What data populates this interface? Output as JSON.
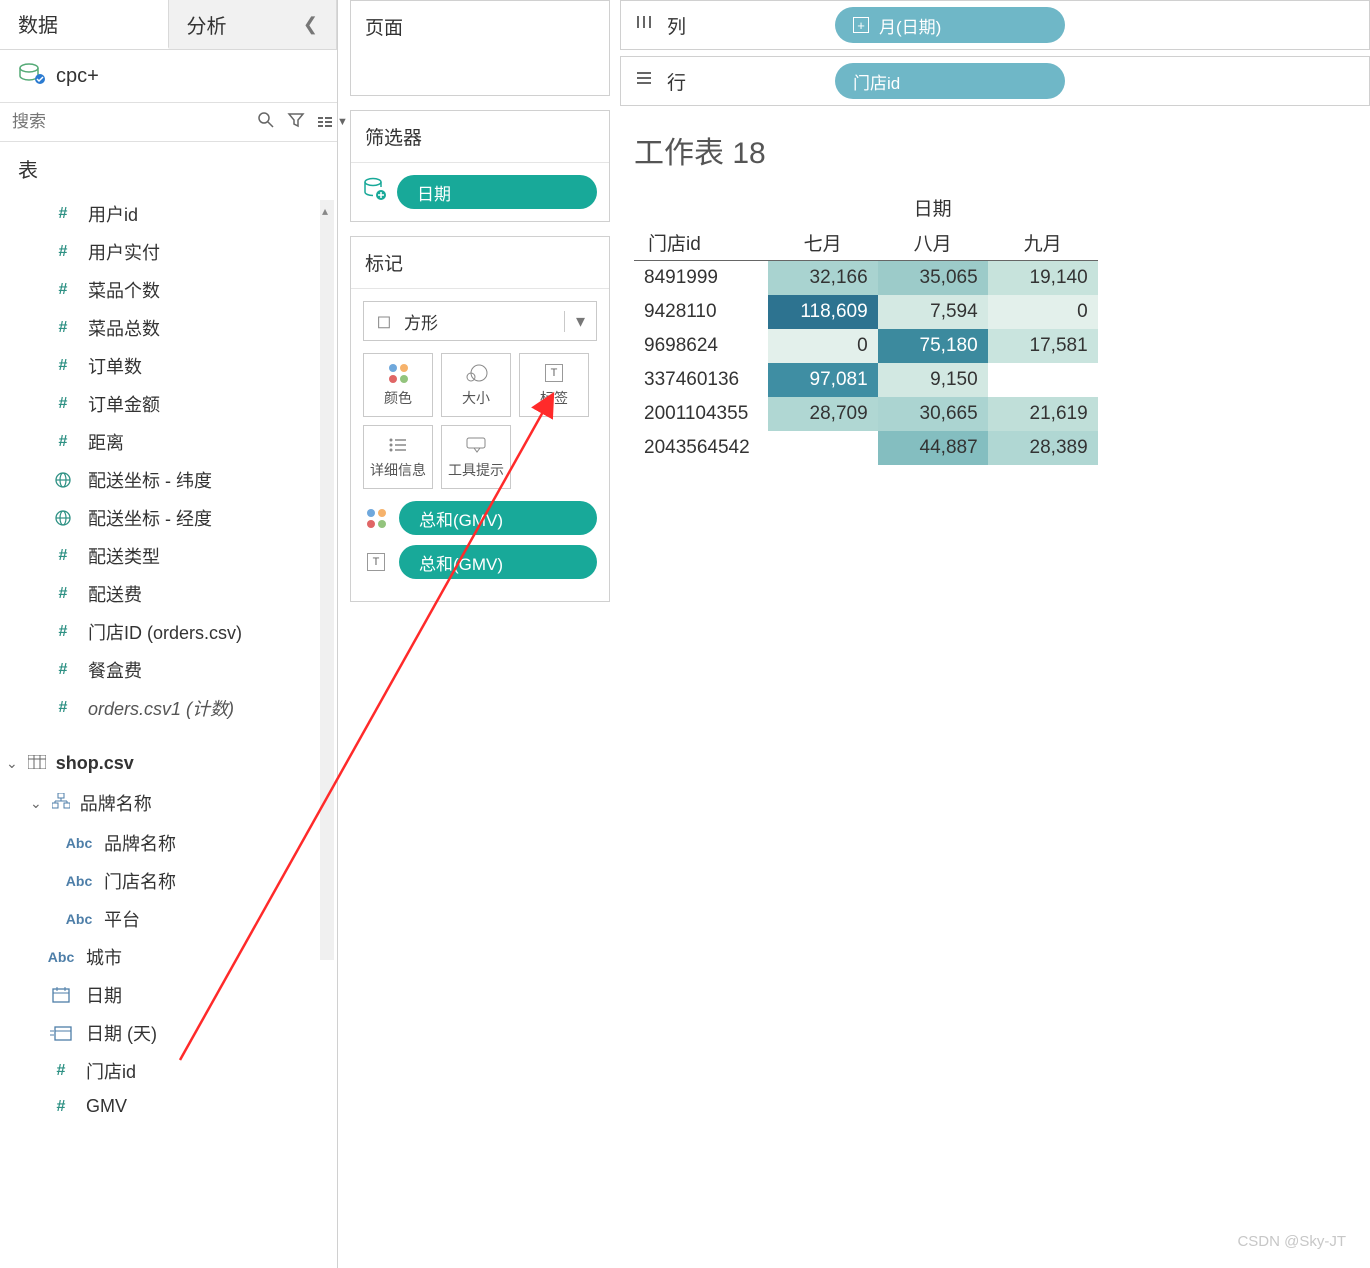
{
  "tabs": {
    "data": "数据",
    "analysis": "分析"
  },
  "datasource": "cpc+",
  "search_placeholder": "搜索",
  "section_tables": "表",
  "fields_orders": [
    {
      "icon": "hash",
      "label": "用户id"
    },
    {
      "icon": "hash",
      "label": "用户实付"
    },
    {
      "icon": "hash",
      "label": "菜品个数"
    },
    {
      "icon": "hash",
      "label": "菜品总数"
    },
    {
      "icon": "hash",
      "label": "订单数"
    },
    {
      "icon": "hash",
      "label": "订单金额"
    },
    {
      "icon": "hash",
      "label": "距离"
    },
    {
      "icon": "globe",
      "label": "配送坐标 - 纬度"
    },
    {
      "icon": "globe",
      "label": "配送坐标 - 经度"
    },
    {
      "icon": "hash",
      "label": "配送类型"
    },
    {
      "icon": "hash",
      "label": "配送费"
    },
    {
      "icon": "hash",
      "label": "门店ID (orders.csv)"
    },
    {
      "icon": "hash",
      "label": "餐盒费"
    },
    {
      "icon": "hash",
      "label": "orders.csv1 (计数)",
      "italic": true
    }
  ],
  "shop_table": "shop.csv",
  "hierarchy": "品牌名称",
  "shop_fields": [
    {
      "icon": "abc",
      "label": "品牌名称",
      "indent": "sub2"
    },
    {
      "icon": "abc",
      "label": "门店名称",
      "indent": "sub2"
    },
    {
      "icon": "abc",
      "label": "平台",
      "indent": "sub2"
    },
    {
      "icon": "abc",
      "label": "城市",
      "indent": "sub3"
    },
    {
      "icon": "date",
      "label": "日期",
      "indent": "sub3"
    },
    {
      "icon": "date2",
      "label": "日期 (天)",
      "indent": "sub3"
    },
    {
      "icon": "hash",
      "label": "门店id",
      "indent": "sub3"
    },
    {
      "icon": "hash",
      "label": "GMV",
      "indent": "sub3"
    }
  ],
  "pages_title": "页面",
  "filters_title": "筛选器",
  "filter_pill": "日期",
  "marks_title": "标记",
  "mark_type": "方形",
  "mark_buttons": {
    "color": "颜色",
    "size": "大小",
    "label": "标签",
    "detail": "详细信息",
    "tooltip": "工具提示"
  },
  "mark_pills": {
    "color": "总和(GMV)",
    "text": "总和(GMV)"
  },
  "columns_label": "列",
  "rows_label": "行",
  "col_pill": "月(日期)",
  "row_pill": "门店id",
  "sheet_title": "工作表 18",
  "chart_data": {
    "type": "table",
    "title": "工作表 18",
    "col_header": "日期",
    "row_header": "门店id",
    "columns": [
      "七月",
      "八月",
      "九月"
    ],
    "rows": [
      {
        "id": "8491999",
        "values": [
          32166,
          35065,
          19140
        ],
        "colors": [
          "#a9d3d0",
          "#9ccbc9",
          "#c7e3dc"
        ]
      },
      {
        "id": "9428110",
        "values": [
          118609,
          7594,
          0
        ],
        "colors": [
          "#2d7390",
          "#d4e9e3",
          "#e3f0eb"
        ]
      },
      {
        "id": "9698624",
        "values": [
          0,
          75180,
          17581
        ],
        "colors": [
          "#e3f0eb",
          "#3c8a9e",
          "#c9e4de"
        ]
      },
      {
        "id": "337460136",
        "values": [
          97081,
          9150,
          null
        ],
        "colors": [
          "#3f8ea3",
          "#d2e8e2",
          null
        ]
      },
      {
        "id": "2001104355",
        "values": [
          28709,
          30665,
          21619
        ],
        "colors": [
          "#b0d7d3",
          "#abd4d1",
          "#c0dfd9"
        ]
      },
      {
        "id": "2043564542",
        "values": [
          null,
          44887,
          28389
        ],
        "colors": [
          null,
          "#84bec0",
          "#b0d7d3"
        ]
      }
    ]
  },
  "watermark": "CSDN @Sky-JT"
}
